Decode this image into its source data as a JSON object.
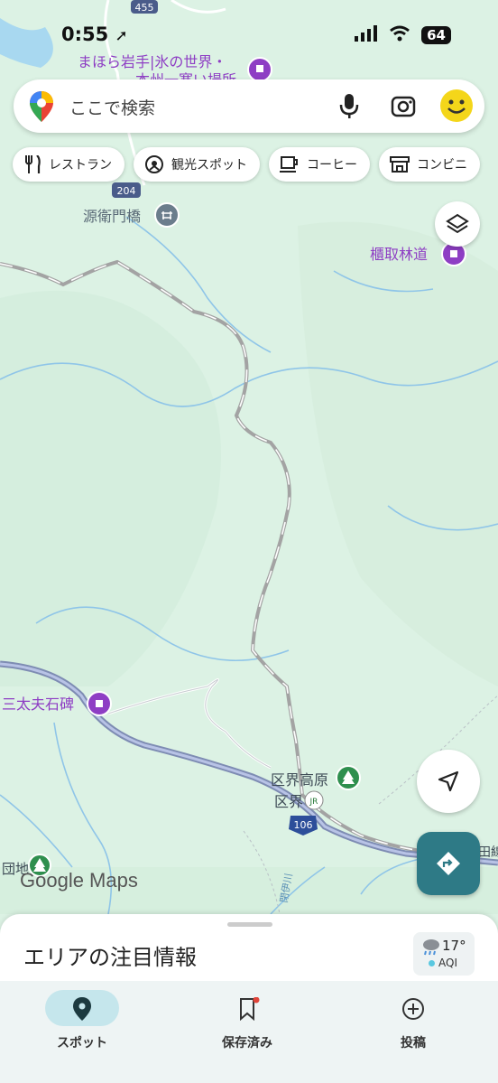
{
  "status_bar": {
    "time": "0:55",
    "battery": "64"
  },
  "search": {
    "placeholder": "ここで検索"
  },
  "chips": [
    {
      "label": "レストラン",
      "icon": "fork-knife-icon"
    },
    {
      "label": "観光スポット",
      "icon": "camera-landmark-icon"
    },
    {
      "label": "コーヒー",
      "icon": "coffee-cup-icon"
    },
    {
      "label": "コンビニ",
      "icon": "store-icon"
    }
  ],
  "map_labels": {
    "top_poi_1": "まほら岩手|氷の世界・",
    "top_poi_2": "本州一寒い場所",
    "route_455": "455",
    "route_204": "204",
    "route_106": "106",
    "bridge": "源衛門橋",
    "forest_road": "櫃取林道",
    "monument": "三太夫石碑",
    "area_1": "区界高原",
    "area_2": "区界",
    "river": "閉伊川",
    "left_edge": "団地",
    "rail_edge": "田線"
  },
  "logo": "Google Maps",
  "sheet": {
    "title": "エリアの注目情報",
    "temperature": "17°",
    "aqi": "AQI"
  },
  "nav": [
    {
      "label": "スポット",
      "icon": "location-pin-icon",
      "active": true
    },
    {
      "label": "保存済み",
      "icon": "bookmark-icon",
      "active": false
    },
    {
      "label": "投稿",
      "icon": "add-circle-icon",
      "active": false
    }
  ],
  "colors": {
    "map_bg": "#dff3e6",
    "poi_purple": "#8e3ec4",
    "direction_teal": "#2e7a86",
    "park_green": "#2f8f4e"
  }
}
